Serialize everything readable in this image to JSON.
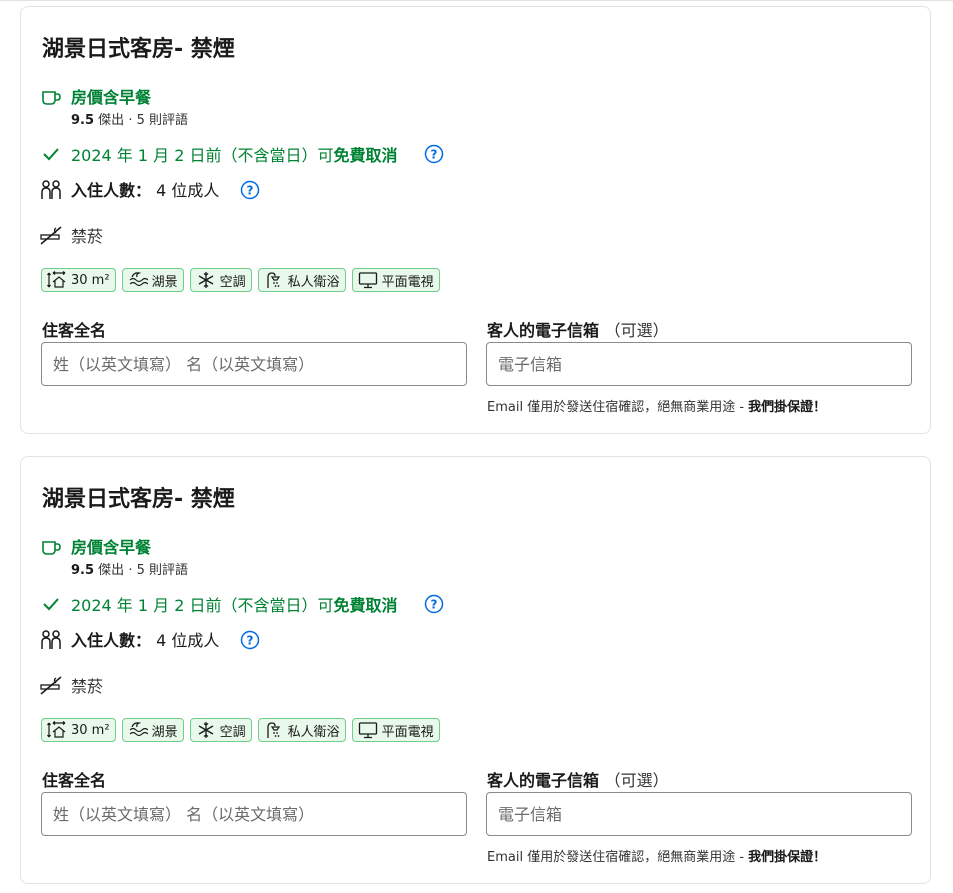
{
  "rooms": [
    {
      "title": "湖景日式客房- 禁煙",
      "breakfast": "房價含早餐",
      "rating_score": "9.5",
      "rating_word": "傑出",
      "rating_sep": "·",
      "reviews": "5 則評語",
      "cancel_prefix": "2024 年 1 月 2 日前（不含當日）可",
      "cancel_strong": "免費取消",
      "occupancy_label": "入住人數：",
      "occupancy_value": "4 位成人",
      "smoking": "禁菸",
      "amenities": [
        "30 m²",
        "湖景",
        "空調",
        "私人衛浴",
        "平面電視"
      ],
      "name_label": "住客全名",
      "name_placeholder": "姓（以英文填寫） 名（以英文填寫）",
      "email_label": "客人的電子信箱",
      "email_optional": "（可選）",
      "email_placeholder": "電子信箱",
      "email_note": "Email 僅用於發送住宿確認，絕無商業用途 - ",
      "email_note_strong": "我們掛保證！"
    },
    {
      "title": "湖景日式客房- 禁煙",
      "breakfast": "房價含早餐",
      "rating_score": "9.5",
      "rating_word": "傑出",
      "rating_sep": "·",
      "reviews": "5 則評語",
      "cancel_prefix": "2024 年 1 月 2 日前（不含當日）可",
      "cancel_strong": "免費取消",
      "occupancy_label": "入住人數：",
      "occupancy_value": "4 位成人",
      "smoking": "禁菸",
      "amenities": [
        "30 m²",
        "湖景",
        "空調",
        "私人衛浴",
        "平面電視"
      ],
      "name_label": "住客全名",
      "name_placeholder": "姓（以英文填寫） 名（以英文填寫）",
      "email_label": "客人的電子信箱",
      "email_optional": "（可選）",
      "email_placeholder": "電子信箱",
      "email_note": "Email 僅用於發送住宿確認，絕無商業用途 - ",
      "email_note_strong": "我們掛保證！"
    }
  ],
  "icons": {
    "breakfast": "coffee-cup-icon",
    "cancel": "checkmark-icon",
    "help": "question-circle-icon",
    "occupancy": "people-icon",
    "smoking": "no-smoking-icon",
    "amenities": [
      "room-size-icon",
      "lake-view-icon",
      "snowflake-icon",
      "shower-icon",
      "tv-icon"
    ]
  },
  "colors": {
    "green": "#008234",
    "help_blue": "#006ce4",
    "amenity_border": "#6fcf8a",
    "amenity_bg": "#e8f8ea"
  }
}
